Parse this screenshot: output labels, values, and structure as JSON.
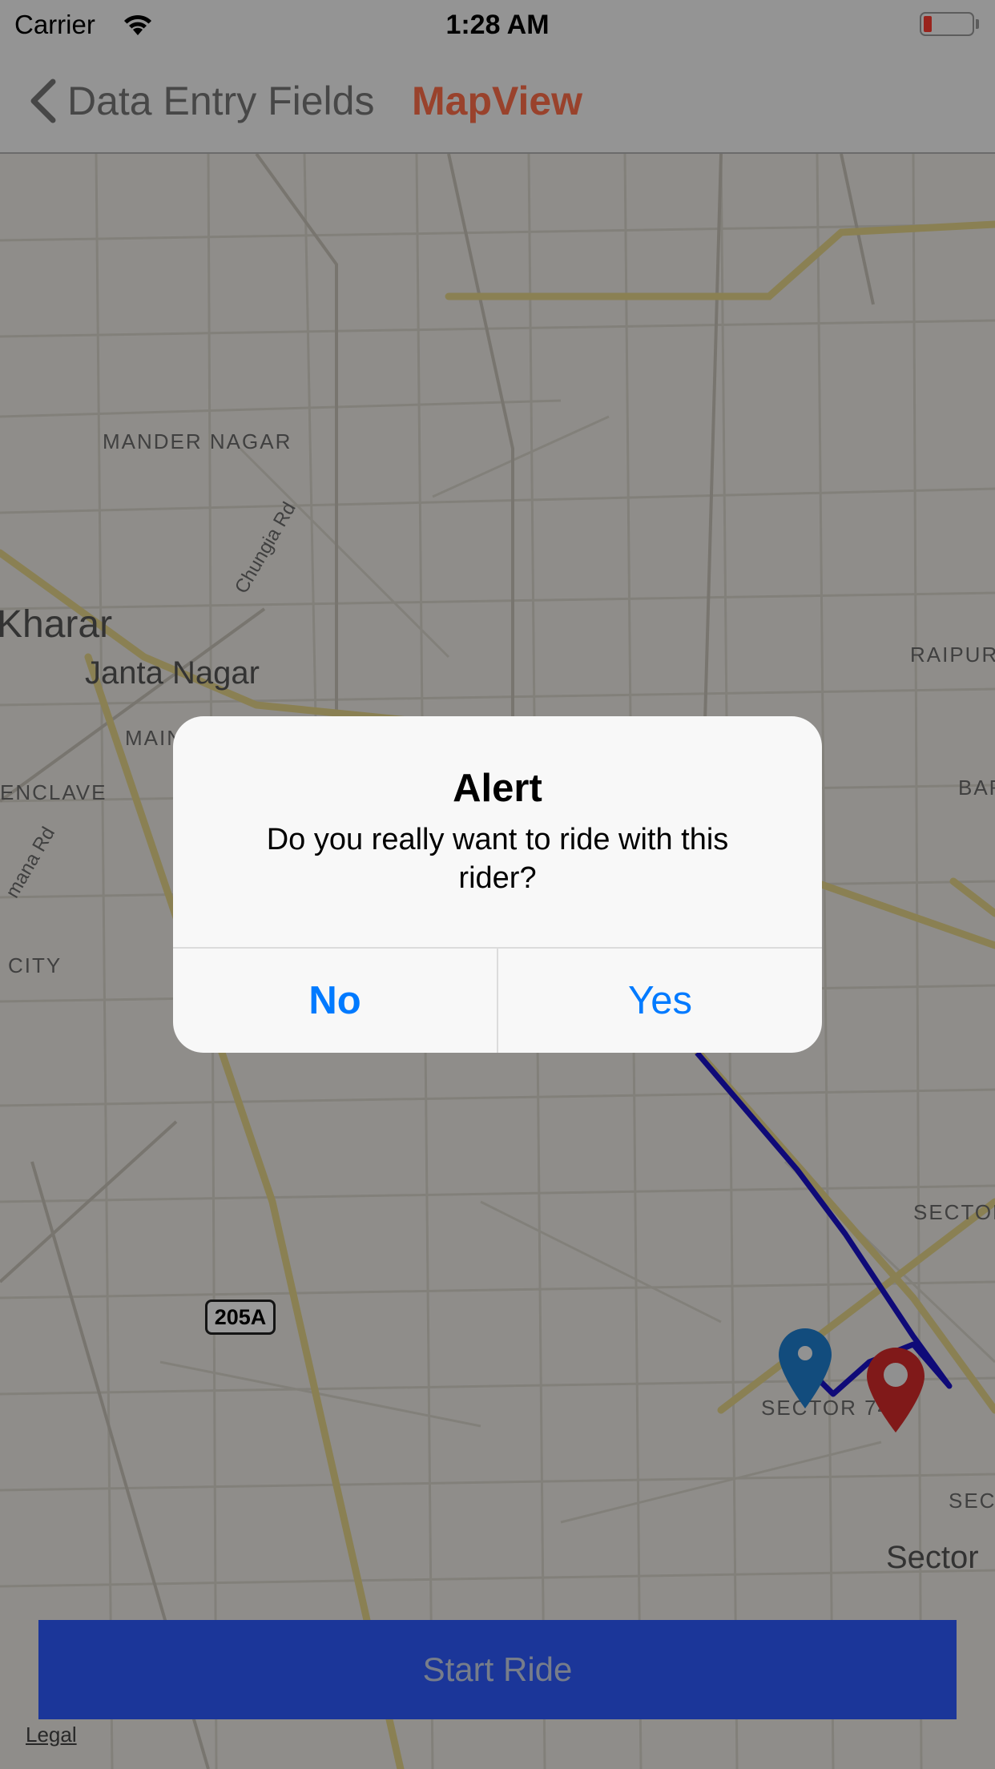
{
  "status_bar": {
    "carrier": "Carrier",
    "time": "1:28 AM"
  },
  "nav_bar": {
    "back_label": "Data Entry Fields",
    "title": "MapView",
    "title_color": "#ff6e4a"
  },
  "map": {
    "labels": {
      "mander_nagar": "MANDER NAGAR",
      "chungia_rd": "Chungia Rd",
      "kharar": "Kharar",
      "janta_nagar": "Janta Nagar",
      "main": "MAIN",
      "enclave": "ENCLAVE",
      "mana_rd": "mana Rd",
      "city": "CITY",
      "raipur": "RAIPUR",
      "bar": "BAR",
      "sector_a": "SECTOR",
      "sector_74": "SECTOR 74",
      "sect": "SECT",
      "sector_big": "Sector"
    },
    "highway_shield": "205A",
    "legal": "Legal",
    "route_color": "#1a12c9",
    "start_pin_color": "#1f7fd1",
    "end_pin_color": "#d62b2b"
  },
  "start_ride": {
    "label": "Start Ride",
    "color": "#2d5bff"
  },
  "alert": {
    "title": "Alert",
    "message": "Do you really want to ride with this rider?",
    "no_label": "No",
    "yes_label": "Yes",
    "button_color": "#007aff"
  }
}
